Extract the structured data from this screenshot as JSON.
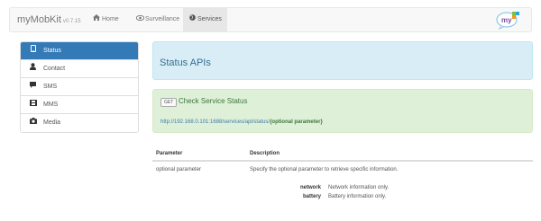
{
  "navbar": {
    "brand": "myMobKit",
    "version": "v0.7.15",
    "items": [
      {
        "label": "Home",
        "icon": "home-icon"
      },
      {
        "label": "Surveillance",
        "icon": "eye-icon"
      },
      {
        "label": "Services",
        "icon": "globe-icon"
      }
    ],
    "logo_text": "my"
  },
  "sidebar": {
    "items": [
      {
        "label": "Status",
        "icon": "mobile-icon",
        "active": true
      },
      {
        "label": "Contact",
        "icon": "user-icon",
        "active": false
      },
      {
        "label": "SMS",
        "icon": "chat-icon",
        "active": false
      },
      {
        "label": "MMS",
        "icon": "film-icon",
        "active": false
      },
      {
        "label": "Media",
        "icon": "camera-icon",
        "active": false
      }
    ]
  },
  "main": {
    "title": "Status APIs",
    "service": {
      "method": "GET",
      "title": "Check Service Status",
      "url": "http://192.168.0.101:1688/services/api/status/",
      "url_param": "{optional parameter}"
    },
    "table": {
      "headers": [
        "Parameter",
        "Description"
      ],
      "rows": [
        {
          "parameter": "optional parameter",
          "description": "Specify the optional parameter to retrieve specific information.",
          "options": [
            {
              "key": "network",
              "value": "Network information only."
            },
            {
              "key": "battery",
              "value": "Battery information only."
            }
          ]
        }
      ]
    }
  },
  "colors": {
    "accent": "#337ab7",
    "info_bg": "#d9edf7",
    "success_bg": "#dff0d8"
  }
}
